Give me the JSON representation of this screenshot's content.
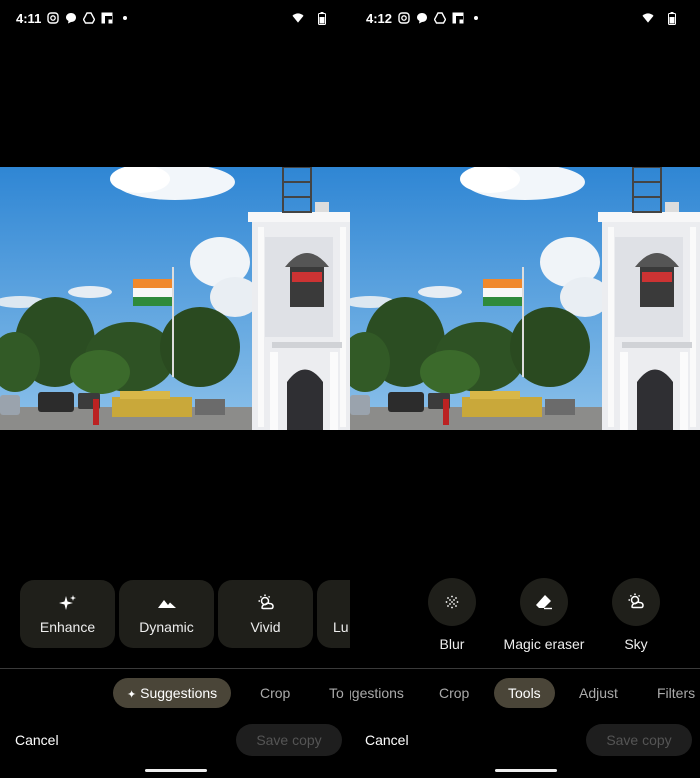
{
  "left": {
    "status": {
      "time": "4:11",
      "icons": [
        "instagram-icon",
        "messenger-icon",
        "drive-icon",
        "flipboard-icon",
        "dot-icon"
      ],
      "right_icons": [
        "wifi-icon",
        "battery-icon"
      ]
    },
    "suggestions": [
      {
        "label": "Enhance",
        "icon": "sparkle-icon"
      },
      {
        "label": "Dynamic",
        "icon": "mountain-icon"
      },
      {
        "label": "Vivid",
        "icon": "sun-cloud-icon"
      },
      {
        "label": "Lu"
      }
    ],
    "tabs": {
      "suggestions": "Suggestions",
      "crop": "Crop",
      "tools_partial": "To"
    },
    "cancel": "Cancel",
    "save_copy": "Save copy"
  },
  "right": {
    "status": {
      "time": "4:12",
      "icons": [
        "instagram-icon",
        "messenger-icon",
        "drive-icon",
        "flipboard-icon",
        "dot-icon"
      ],
      "right_icons": [
        "wifi-icon",
        "battery-icon"
      ]
    },
    "tools": [
      {
        "label": "Blur",
        "icon": "blur-icon"
      },
      {
        "label": "Magic eraser",
        "icon": "eraser-icon"
      },
      {
        "label": "Sky",
        "icon": "sky-icon"
      }
    ],
    "tabs": {
      "suggestions_partial": "ggestions",
      "crop": "Crop",
      "tools": "Tools",
      "adjust": "Adjust",
      "filters": "Filters"
    },
    "cancel": "Cancel",
    "save_copy": "Save copy"
  },
  "colors": {
    "chip_bg": "#1f1f1a",
    "active_tab_bg": "#4a4538",
    "sky": "#3d8fd6"
  }
}
